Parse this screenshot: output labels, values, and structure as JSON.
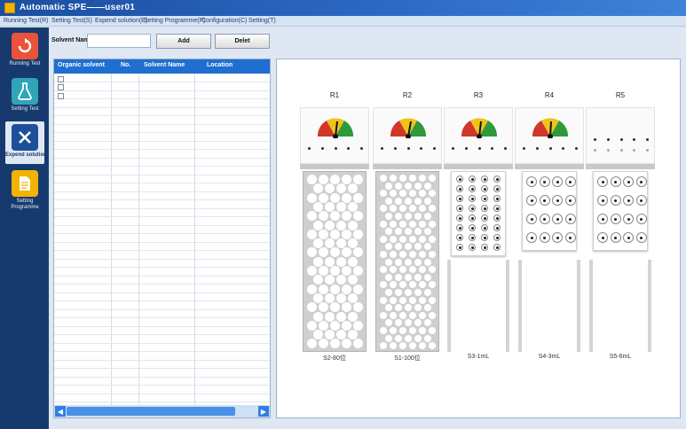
{
  "window": {
    "title": "Automatic SPE——user01"
  },
  "menu": [
    "Running Test(R)",
    "Setting Test(S)",
    "Expend solution(E)",
    "Setting Programme(P)",
    "Configuration(C)",
    "Setting(T)"
  ],
  "sidebar": [
    {
      "label": "Running Test",
      "icon": "refresh-icon",
      "color": "#e8533a"
    },
    {
      "label": "Setting Test",
      "icon": "flask-icon",
      "color": "#2fa6b8"
    },
    {
      "label": "Expend solution",
      "icon": "shuffle-icon",
      "color": "#1e4f9a",
      "active": true
    },
    {
      "label": "Setting Programme",
      "icon": "document-icon",
      "color": "#f2b400"
    }
  ],
  "toolbar": {
    "solvent_label": "Solvent Name",
    "solvent_value": "",
    "add_label": "Add",
    "delete_label": "Delet"
  },
  "table": {
    "columns": [
      "Organic solvent",
      "No.",
      "Solvent Name",
      "Location"
    ],
    "checkbox_rows": 3
  },
  "racks": [
    {
      "name": "R1",
      "footer": "S2-80位"
    },
    {
      "name": "R2",
      "footer": "S1-100位"
    },
    {
      "name": "R3",
      "footer": "S3-1mL"
    },
    {
      "name": "R4",
      "footer": "S4-3mL"
    },
    {
      "name": "R5",
      "footer": "S5-6mL"
    }
  ],
  "colors": {
    "titlebar": "#1b4fa0",
    "sidebar": "#173a6e",
    "table_header": "#1e6fd0"
  }
}
